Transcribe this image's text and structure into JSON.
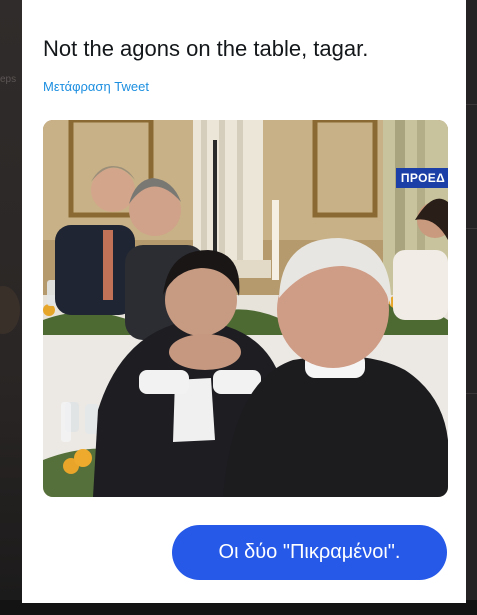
{
  "tweet": {
    "text": "Not the agons on the table, tagar.",
    "translate_label": "Μετάφραση Tweet",
    "media": {
      "broadcast_badge": "ΠΡΟΕΔ"
    }
  },
  "caption_bubble": {
    "text": "Οι δύο \"Πικραμένοι\"."
  },
  "colors": {
    "link": "#1d8fe0",
    "bubble": "#2659e8",
    "badge": "#1b3fa6",
    "card": "#ffffff",
    "backdrop": "#1f1d1e"
  }
}
